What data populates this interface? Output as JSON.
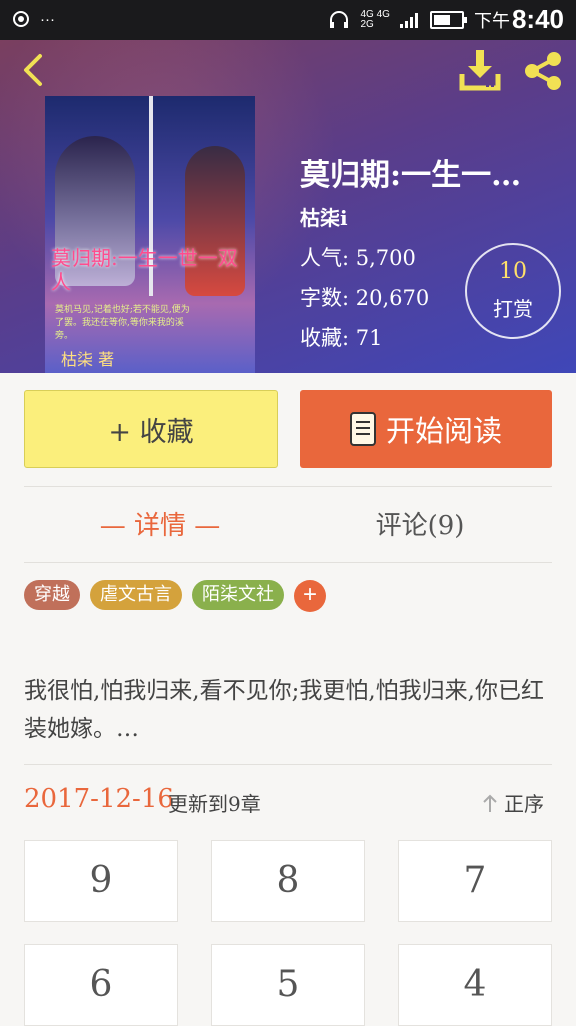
{
  "status": {
    "time": "8:40",
    "ampm": "下午",
    "net_top": "4G 4G",
    "net_bottom": "2G",
    "left_dots": "···",
    "battery_level": 0.6
  },
  "book": {
    "title": "莫归期:一生一…",
    "author": "枯柒i",
    "stats": {
      "popularity": "人气: 5,700",
      "words": "字数: 20,670",
      "favorites": "收藏: 71"
    },
    "tip": {
      "count": "10",
      "label": "打赏"
    },
    "cover": {
      "title": "莫归期:一生一世一双人",
      "verse": "莫机马见,记着也好;若不能见,便为了罢。我还在等你,等你来我的溪旁。",
      "author": "枯柒 著"
    }
  },
  "actions": {
    "collect": "+ 收藏",
    "read": "开始阅读"
  },
  "tabs": {
    "details": "— 详情 —",
    "comments": "评论(9)"
  },
  "tags": [
    {
      "label": "穿越",
      "color": "#c0705a"
    },
    {
      "label": "虐文古言",
      "color": "#d4a23c"
    },
    {
      "label": "陌柒文社",
      "color": "#8ab04c"
    }
  ],
  "tag_add": "+",
  "synopsis": "我很怕,怕我归来,看不见你;我更怕,怕我归来,你已红装她嫁。…",
  "update": {
    "date": "2017-12-16",
    "text": "更新到9章",
    "sort": "正序"
  },
  "chapters": [
    "9",
    "8",
    "7",
    "6",
    "5",
    "4"
  ],
  "colors": {
    "accent": "#e9673c",
    "collect_bg": "#fbef7c",
    "icon_yellow": "#f1e154"
  }
}
